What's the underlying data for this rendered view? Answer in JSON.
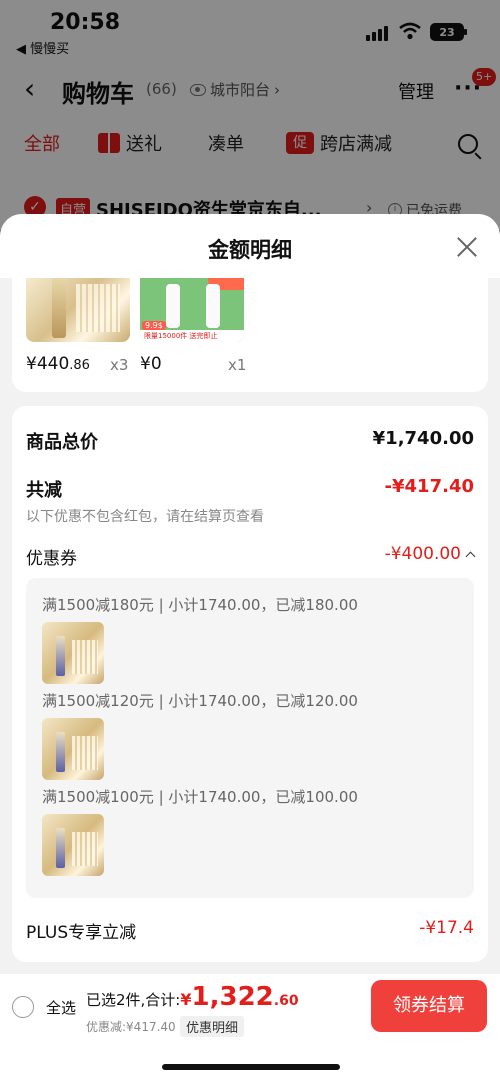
{
  "status_bar": {
    "time": "20:58",
    "back_app": "◀ 慢慢买",
    "battery": "23"
  },
  "navbar": {
    "title": "购物车",
    "count": "(66)",
    "location": "城市阳台",
    "manage": "管理",
    "more_badge": "5+"
  },
  "tabs": [
    {
      "label": "全部",
      "active": true
    },
    {
      "label": "送礼",
      "active": false
    },
    {
      "label": "凑单",
      "active": false
    },
    {
      "label": "跨店满减",
      "active": false,
      "prefix": "促"
    }
  ],
  "shop": {
    "tag": "自营",
    "name": "SHISEIDO资生堂京东自...",
    "shipping": "已免运费"
  },
  "sheet": {
    "title": "金额明细",
    "goods": [
      {
        "price_main": "¥440",
        "price_dec": ".86",
        "qty": "x3"
      },
      {
        "price_main": "¥0",
        "price_dec": "",
        "qty": "x1",
        "promo_tag": "9.9$",
        "strip_text": "限量15000件 送完即止"
      }
    ],
    "total": {
      "label": "商品总价",
      "value": "¥1,740.00"
    },
    "reduce": {
      "label": "共减",
      "value": "-¥417.40",
      "note": "以下优惠不包含红包，请在结算页查看"
    },
    "coupon": {
      "label": "优惠券",
      "value": "-¥400.00",
      "items": [
        {
          "text": "满1500减180元 | 小计1740.00，已减180.00"
        },
        {
          "text": "满1500减120元 | 小计1740.00，已减120.00"
        },
        {
          "text": "满1500减100元 | 小计1740.00，已减100.00"
        }
      ]
    },
    "plus": {
      "label": "PLUS专享立减",
      "value": "-¥17.4"
    }
  },
  "bottom": {
    "select_all": "全选",
    "summary_prefix": "已选2件,合计:",
    "yen": "¥",
    "total_main": "1,322",
    "total_dec": ".60",
    "saved": "优惠减:¥417.40",
    "detail_link": "优惠明细",
    "checkout": "领券结算"
  },
  "colors": {
    "accent": "#e31d1a",
    "checkout_bg": "#f0403c"
  }
}
